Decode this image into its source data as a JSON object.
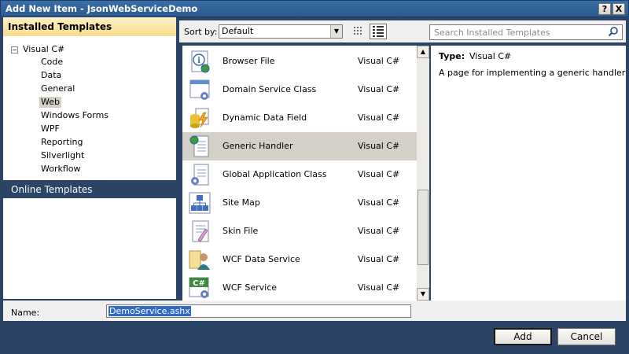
{
  "window": {
    "title": "Add New Item - JsonWebServiceDemo",
    "help_button": "?",
    "close_button": "X"
  },
  "left_panel": {
    "header": "Installed Templates",
    "tree": {
      "root": {
        "toggle": "−",
        "label": "Visual C#"
      },
      "children": [
        "Code",
        "Data",
        "General",
        "Web",
        "Windows Forms",
        "WPF",
        "Reporting",
        "Silverlight",
        "Workflow"
      ],
      "selected": "Web"
    },
    "online_templates": "Online Templates"
  },
  "toolbar": {
    "sort_label": "Sort by:",
    "sort_value": "Default",
    "search_placeholder": "Search Installed Templates"
  },
  "items": [
    {
      "name": "Browser File",
      "lang": "Visual C#",
      "icon": "browser-file-icon"
    },
    {
      "name": "Domain Service Class",
      "lang": "Visual C#",
      "icon": "domain-service-icon"
    },
    {
      "name": "Dynamic Data Field",
      "lang": "Visual C#",
      "icon": "dynamic-data-icon"
    },
    {
      "name": "Generic Handler",
      "lang": "Visual C#",
      "icon": "generic-handler-icon",
      "selected": true
    },
    {
      "name": "Global Application Class",
      "lang": "Visual C#",
      "icon": "global-app-icon"
    },
    {
      "name": "Site Map",
      "lang": "Visual C#",
      "icon": "site-map-icon"
    },
    {
      "name": "Skin File",
      "lang": "Visual C#",
      "icon": "skin-file-icon"
    },
    {
      "name": "WCF Data Service",
      "lang": "Visual C#",
      "icon": "wcf-data-service-icon"
    },
    {
      "name": "WCF Service",
      "lang": "Visual C#",
      "icon": "wcf-service-icon"
    }
  ],
  "details": {
    "type_label": "Type:",
    "type_value": "Visual C#",
    "description": "A page for implementing a generic handler"
  },
  "name_field": {
    "label": "Name:",
    "value": "DemoService.ashx"
  },
  "buttons": {
    "add": "Add",
    "cancel": "Cancel"
  },
  "colors": {
    "frame": "#2c4566",
    "header_gold": "#f8dd8c",
    "selection": "#d4d0c8"
  }
}
